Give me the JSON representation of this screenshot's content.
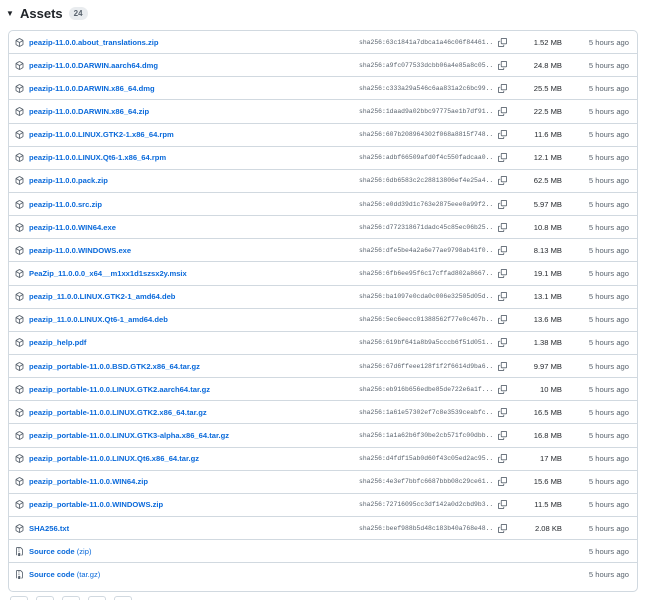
{
  "section": {
    "title": "Assets",
    "count": "24"
  },
  "assets": [
    {
      "name": "peazip-11.0.0.about_translations.zip",
      "sha": "sha256:63c1841a7dbca1a46c06f84461...",
      "size": "1.52 MB",
      "time": "5 hours ago",
      "icon": "package-icon"
    },
    {
      "name": "peazip-11.0.0.DARWIN.aarch64.dmg",
      "sha": "sha256:a9fc077533dcbb06a4e85a8c05...",
      "size": "24.8 MB",
      "time": "5 hours ago",
      "icon": "package-icon"
    },
    {
      "name": "peazip-11.0.0.DARWIN.x86_64.dmg",
      "sha": "sha256:c333a29a546c6aa831a2c6bc99...",
      "size": "25.5 MB",
      "time": "5 hours ago",
      "icon": "package-icon"
    },
    {
      "name": "peazip-11.0.0.DARWIN.x86_64.zip",
      "sha": "sha256:1daad9a02bbc97775ae1b7df91...",
      "size": "22.5 MB",
      "time": "5 hours ago",
      "icon": "package-icon"
    },
    {
      "name": "peazip-11.0.0.LINUX.GTK2-1.x86_64.rpm",
      "sha": "sha256:607b208964302f068a8815f748...",
      "size": "11.6 MB",
      "time": "5 hours ago",
      "icon": "package-icon"
    },
    {
      "name": "peazip-11.0.0.LINUX.Qt6-1.x86_64.rpm",
      "sha": "sha256:adbf66509afd0f4c550fadcaa0...",
      "size": "12.1 MB",
      "time": "5 hours ago",
      "icon": "package-icon"
    },
    {
      "name": "peazip-11.0.0.pack.zip",
      "sha": "sha256:6db6583c2c28813806ef4e25a4...",
      "size": "62.5 MB",
      "time": "5 hours ago",
      "icon": "package-icon"
    },
    {
      "name": "peazip-11.0.0.src.zip",
      "sha": "sha256:e0dd39d1c763e2875eee0a99f2...",
      "size": "5.97 MB",
      "time": "5 hours ago",
      "icon": "package-icon"
    },
    {
      "name": "peazip-11.0.0.WIN64.exe",
      "sha": "sha256:d772318671dadc45c85ec06b25...",
      "size": "10.8 MB",
      "time": "5 hours ago",
      "icon": "package-icon"
    },
    {
      "name": "peazip-11.0.0.WINDOWS.exe",
      "sha": "sha256:dfe5be4a2a6e77ae9798ab41f0...",
      "size": "8.13 MB",
      "time": "5 hours ago",
      "icon": "package-icon"
    },
    {
      "name": "PeaZip_11.0.0.0_x64__m1xx1d1szsx2y.msix",
      "sha": "sha256:6fb6ee95f6c17cffad802a8667...",
      "size": "19.1 MB",
      "time": "5 hours ago",
      "icon": "package-icon"
    },
    {
      "name": "peazip_11.0.0.LINUX.GTK2-1_amd64.deb",
      "sha": "sha256:ba1097e0cda0c006e32505d05d...",
      "size": "13.1 MB",
      "time": "5 hours ago",
      "icon": "package-icon"
    },
    {
      "name": "peazip_11.0.0.LINUX.Qt6-1_amd64.deb",
      "sha": "sha256:5ec6eecc01388562f77e0c467b...",
      "size": "13.6 MB",
      "time": "5 hours ago",
      "icon": "package-icon"
    },
    {
      "name": "peazip_help.pdf",
      "sha": "sha256:619bf641a8b9a5cccb6f51d051...",
      "size": "1.38 MB",
      "time": "5 hours ago",
      "icon": "package-icon"
    },
    {
      "name": "peazip_portable-11.0.0.BSD.GTK2.x86_64.tar.gz",
      "sha": "sha256:67d6ffeee128f1f2f6614d9ba6...",
      "size": "9.97 MB",
      "time": "5 hours ago",
      "icon": "package-icon"
    },
    {
      "name": "peazip_portable-11.0.0.LINUX.GTK2.aarch64.tar.gz",
      "sha": "sha256:eb916b656edbe85de722e6a1f...",
      "size": "10 MB",
      "time": "5 hours ago",
      "icon": "package-icon"
    },
    {
      "name": "peazip_portable-11.0.0.LINUX.GTK2.x86_64.tar.gz",
      "sha": "sha256:1a61e57302ef7c8e3539ceabfc...",
      "size": "16.5 MB",
      "time": "5 hours ago",
      "icon": "package-icon"
    },
    {
      "name": "peazip_portable-11.0.0.LINUX.GTK3-alpha.x86_64.tar.gz",
      "sha": "sha256:1a1a62b6f30be2cb571fc00dbb...",
      "size": "16.8 MB",
      "time": "5 hours ago",
      "icon": "package-icon"
    },
    {
      "name": "peazip_portable-11.0.0.LINUX.Qt6.x86_64.tar.gz",
      "sha": "sha256:d4fdf15ab0d60f43c05ed2ac95...",
      "size": "17 MB",
      "time": "5 hours ago",
      "icon": "package-icon"
    },
    {
      "name": "peazip_portable-11.0.0.WIN64.zip",
      "sha": "sha256:4e3ef7bbfc6687bbb08c29ce61...",
      "size": "15.6 MB",
      "time": "5 hours ago",
      "icon": "package-icon"
    },
    {
      "name": "peazip_portable-11.0.0.WINDOWS.zip",
      "sha": "sha256:72716095cc3df142a0d2cbd9b3...",
      "size": "11.5 MB",
      "time": "5 hours ago",
      "icon": "package-icon"
    },
    {
      "name": "SHA256.txt",
      "sha": "sha256:beef988b5d48c183b40a768e48...",
      "size": "2.08 KB",
      "time": "5 hours ago",
      "icon": "package-icon"
    }
  ],
  "sources": [
    {
      "name": "Source code",
      "paren": "(zip)",
      "time": "5 hours ago",
      "icon": "file-zip-icon"
    },
    {
      "name": "Source code",
      "paren": "(tar.gz)",
      "time": "5 hours ago",
      "icon": "file-zip-icon"
    }
  ],
  "colors": {
    "link": "#0969da",
    "muted": "#59636e",
    "border": "#d1d9e0"
  }
}
